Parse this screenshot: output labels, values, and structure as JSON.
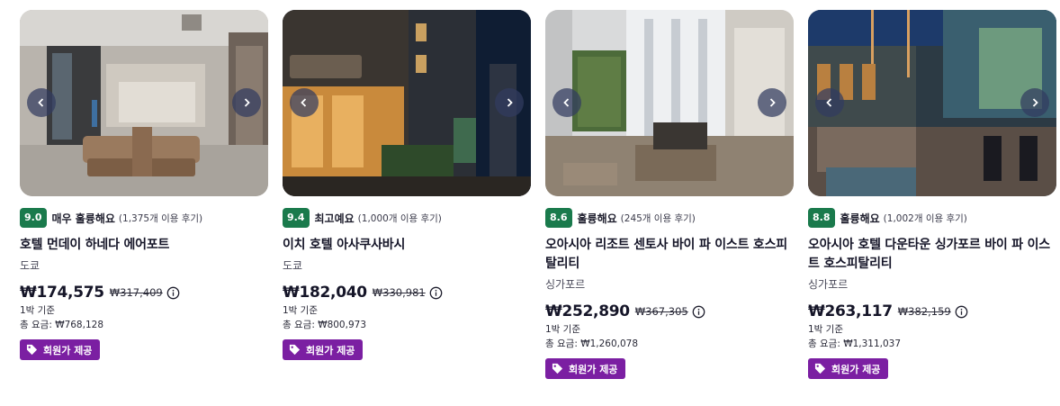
{
  "hotels": [
    {
      "score": "9.0",
      "rating_word": "매우 훌륭해요",
      "reviews": "(1,375개 이용 후기)",
      "name": "호텔 먼데이 하네다 에어포트",
      "city": "도쿄",
      "price": "₩174,575",
      "original_price": "₩317,409",
      "per_night": "1박 기준",
      "total": "총 요금: ₩768,128",
      "badge": "회원가 제공",
      "photo": "hotel-lobby-photo"
    },
    {
      "score": "9.4",
      "rating_word": "최고예요",
      "reviews": "(1,000개 이용 후기)",
      "name": "이치 호텔 아사쿠사바시",
      "city": "도쿄",
      "price": "₩182,040",
      "original_price": "₩330,981",
      "per_night": "1박 기준",
      "total": "총 요금: ₩800,973",
      "badge": "회원가 제공",
      "photo": "hotel-exterior-night-photo"
    },
    {
      "score": "8.6",
      "rating_word": "훌륭해요",
      "reviews": "(245개 이용 후기)",
      "name": "오아시아 리조트 센토사 바이 파 이스트 호스피탈리티",
      "city": "싱가포르",
      "price": "₩252,890",
      "original_price": "₩367,305",
      "per_night": "1박 기준",
      "total": "총 요금: ₩1,260,078",
      "badge": "회원가 제공",
      "photo": "resort-lobby-photo"
    },
    {
      "score": "8.8",
      "rating_word": "훌륭해요",
      "reviews": "(1,002개 이용 후기)",
      "name": "오아시아 호텔 다운타운 싱가포르 바이 파 이스트 호스피탈리티",
      "city": "싱가포르",
      "price": "₩263,117",
      "original_price": "₩382,159",
      "per_night": "1박 기준",
      "total": "총 요금: ₩1,311,037",
      "badge": "회원가 제공",
      "photo": "hotel-bar-photo"
    }
  ],
  "colors": {
    "score_bg": "#1a7a4c",
    "badge_bg": "#7b1fa2",
    "nav_button": "#323c5f"
  },
  "icons": {
    "prev": "chevron-left-icon",
    "next": "chevron-right-icon",
    "info": "info-icon",
    "tag": "tag-icon"
  }
}
